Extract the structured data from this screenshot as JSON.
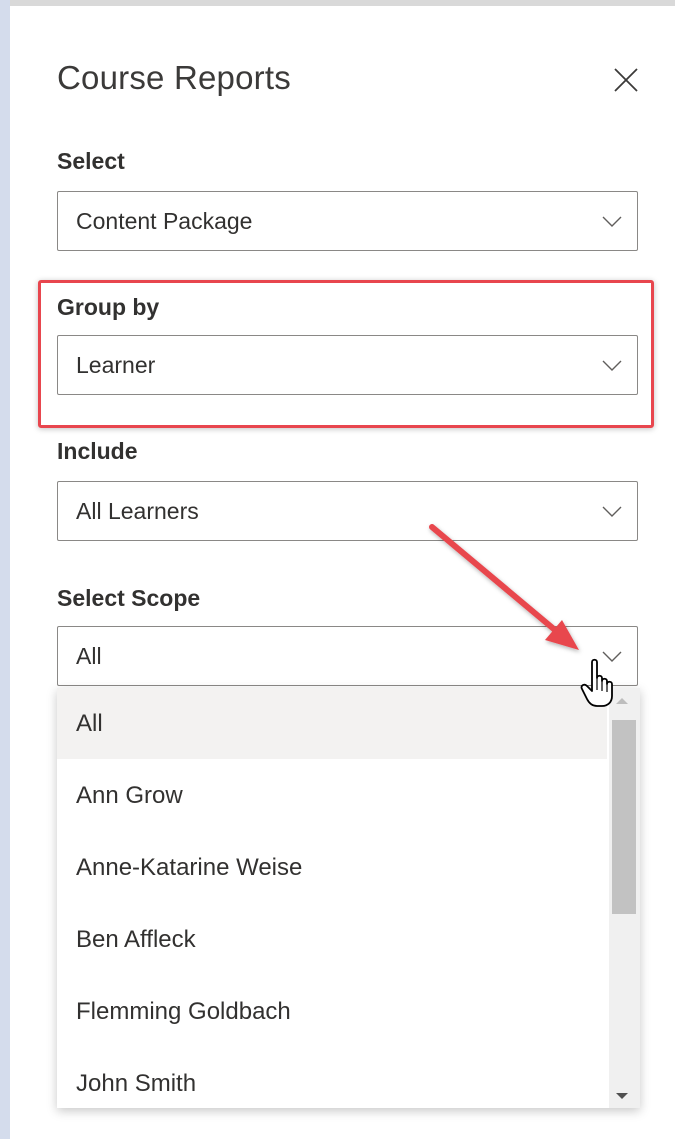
{
  "panel": {
    "title": "Course Reports",
    "close_icon": "close-icon"
  },
  "fields": {
    "select": {
      "label": "Select",
      "value": "Content Package"
    },
    "group_by": {
      "label": "Group by",
      "value": "Learner"
    },
    "include": {
      "label": "Include",
      "value": "All Learners"
    },
    "scope": {
      "label": "Select Scope",
      "value": "All"
    }
  },
  "scope_options": [
    "All",
    "Ann Grow",
    "Anne-Katarine Weise",
    "Ben Affleck",
    "Flemming Goldbach",
    "John Smith"
  ],
  "selected_option_index": 0,
  "colors": {
    "highlight": "#e8464e",
    "arrow": "#e8464e",
    "border": "#8a8886",
    "text": "#323130",
    "selected_bg": "#f3f2f1"
  },
  "icons": {
    "chevron": "chevron-down-icon",
    "cursor": "hand-pointer-icon",
    "arrow": "red-arrow-annotation"
  }
}
